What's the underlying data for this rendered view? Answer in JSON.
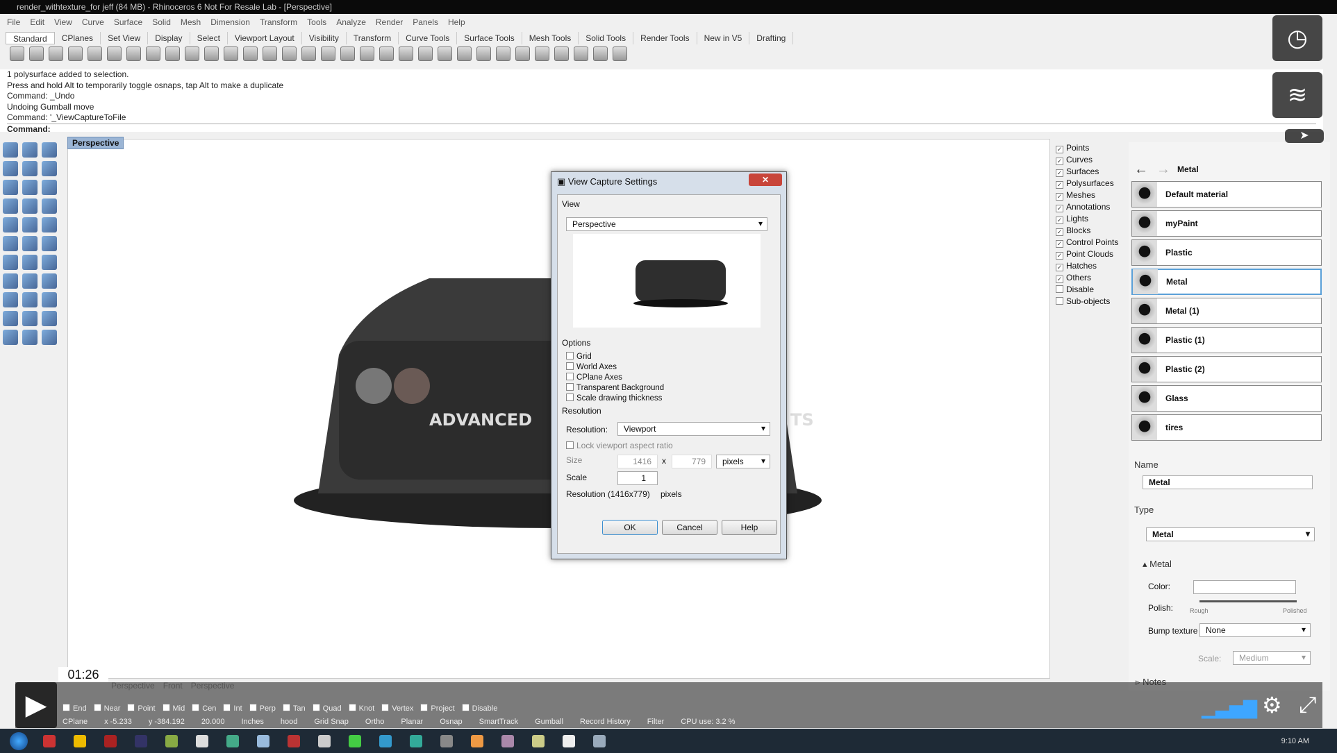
{
  "window": {
    "title": "render_withtexture_for jeff (84 MB) - Rhinoceros 6 Not For Resale Lab - [Perspective]"
  },
  "menu": [
    "File",
    "Edit",
    "View",
    "Curve",
    "Surface",
    "Solid",
    "Mesh",
    "Dimension",
    "Transform",
    "Tools",
    "Analyze",
    "Render",
    "Panels",
    "Help"
  ],
  "toolbar_tabs": [
    "Standard",
    "CPlanes",
    "Set View",
    "Display",
    "Select",
    "Viewport Layout",
    "Visibility",
    "Transform",
    "Curve Tools",
    "Surface Tools",
    "Mesh Tools",
    "Solid Tools",
    "Render Tools",
    "New in V5",
    "Drafting"
  ],
  "command_history": [
    "1 polysurface added to selection.",
    "Press and hold Alt to temporarily toggle osnaps, tap Alt to make a duplicate",
    "Command: _Undo",
    "Undoing Gumball move",
    "Command: '_ViewCaptureToFile"
  ],
  "command_prompt": "Command:",
  "viewport": {
    "tab": "Perspective",
    "car_text_left": "ADVANCED",
    "car_text_right": "TS",
    "bottom_tabs": [
      "Perspective",
      "Front",
      "Perspective"
    ]
  },
  "filters": [
    {
      "label": "Points",
      "checked": true
    },
    {
      "label": "Curves",
      "checked": true
    },
    {
      "label": "Surfaces",
      "checked": true
    },
    {
      "label": "Polysurfaces",
      "checked": true
    },
    {
      "label": "Meshes",
      "checked": true
    },
    {
      "label": "Annotations",
      "checked": true
    },
    {
      "label": "Lights",
      "checked": true
    },
    {
      "label": "Blocks",
      "checked": true
    },
    {
      "label": "Control Points",
      "checked": true
    },
    {
      "label": "Point Clouds",
      "checked": true
    },
    {
      "label": "Hatches",
      "checked": true
    },
    {
      "label": "Others",
      "checked": true
    },
    {
      "label": "Disable",
      "checked": false
    },
    {
      "label": "Sub-objects",
      "checked": false
    }
  ],
  "materials": {
    "breadcrumb": "Metal",
    "items": [
      "Default material",
      "myPaint",
      "Plastic",
      "Metal",
      "Metal (1)",
      "Plastic (1)",
      "Plastic (2)",
      "Glass",
      "tires"
    ],
    "selected": "Metal",
    "name_label": "Name",
    "name_value": "Metal",
    "type_label": "Type",
    "type_value": "Metal",
    "section": "Metal",
    "color_label": "Color:",
    "polish_label": "Polish:",
    "polish_min": "Rough",
    "polish_max": "Polished",
    "polish_value": 1.0,
    "bump_label": "Bump texture",
    "bump_value": "None",
    "scale_label": "Scale:",
    "scale_value": "Medium",
    "notes_label": "Notes"
  },
  "dialog": {
    "title": "View Capture Settings",
    "view_section": "View",
    "view_value": "Perspective",
    "options_section": "Options",
    "options": [
      {
        "label": "Grid",
        "checked": false
      },
      {
        "label": "World Axes",
        "checked": false
      },
      {
        "label": "CPlane Axes",
        "checked": false
      },
      {
        "label": "Transparent Background",
        "checked": false
      },
      {
        "label": "Scale drawing thickness",
        "checked": false
      }
    ],
    "resolution_section": "Resolution",
    "resolution_label": "Resolution:",
    "resolution_value": "Viewport",
    "lock_label": "Lock viewport aspect ratio",
    "size_label": "Size",
    "width": "1416",
    "x": "x",
    "height": "779",
    "unit": "pixels",
    "scale_label": "Scale",
    "scale_value": "1",
    "res_summary": "Resolution  (1416x779)",
    "res_unit": "pixels",
    "ok": "OK",
    "cancel": "Cancel",
    "help": "Help"
  },
  "osnaps": [
    "End",
    "Near",
    "Point",
    "Mid",
    "Cen",
    "Int",
    "Perp",
    "Tan",
    "Quad",
    "Knot",
    "Vertex",
    "Project",
    "Disable"
  ],
  "status": {
    "cplane": "CPlane",
    "x": "x -5.233",
    "y": "y -384.192",
    "z": "20.000",
    "units": "Inches",
    "layer": "hood",
    "items": [
      "Grid Snap",
      "Ortho",
      "Planar",
      "Osnap",
      "SmartTrack",
      "Gumball",
      "Record History",
      "Filter",
      "CPU use: 3.2 %"
    ]
  },
  "video": {
    "time": "01:26",
    "clock": "9:10 AM"
  }
}
